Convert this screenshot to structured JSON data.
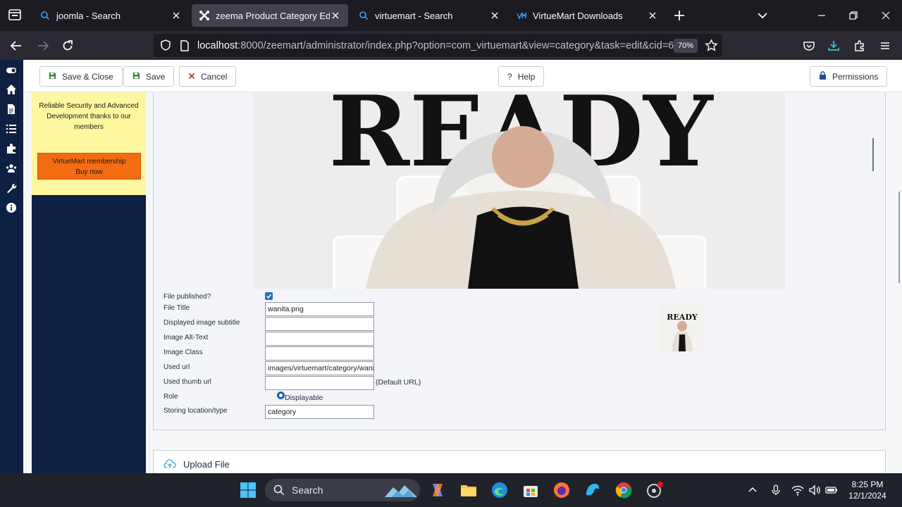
{
  "browser": {
    "tabs": [
      {
        "label": "joomla - Search",
        "active": false
      },
      {
        "label": "zeema Product Category Edit",
        "active": true
      },
      {
        "label": "virtuemart - Search",
        "active": false
      },
      {
        "label": "VirtueMart Downloads",
        "active": false
      }
    ],
    "url": {
      "host": "localhost",
      "rest": ":8000/zeemart/administrator/index.php?option=com_virtuemart&view=category&task=edit&cid=6"
    },
    "zoom": "70%"
  },
  "toolbar": {
    "save_close": "Save & Close",
    "save": "Save",
    "cancel": "Cancel",
    "help": "Help",
    "permissions": "Permissions"
  },
  "promo": {
    "text": "Reliable Security and Advanced Development thanks to our members",
    "button_line1": "VirtueMart membership",
    "button_line2": "Buy now"
  },
  "image": {
    "headline": "READY",
    "thumb_text": "READY"
  },
  "form": {
    "published_label": "File published?",
    "published": true,
    "title_label": "File Title",
    "title_value": "wanita.png",
    "subtitle_label": "Displayed image subtitle",
    "subtitle_value": "",
    "alt_label": "Image Alt-Text",
    "alt_value": "",
    "class_label": "Image Class",
    "class_value": "",
    "url_label": "Used url",
    "url_value": "images/virtuemart/category/wanita.png",
    "thumb_label": "Used thumb url",
    "thumb_value": "",
    "thumb_hint": "(Default URL)",
    "role_label": "Role",
    "role_value": "Displayable",
    "storage_label": "Storing location/type",
    "storage_value": "category"
  },
  "upload": {
    "title": "Upload File"
  },
  "taskbar": {
    "search_label": "Search",
    "time": "8:25 PM",
    "date": "12/1/2024"
  },
  "colors": {
    "joomla_nav": "#0f2142",
    "promo_bg": "#fff79f",
    "promo_button": "#f36c12",
    "save_green": "#2f7d32",
    "cancel_red": "#c0392b"
  }
}
